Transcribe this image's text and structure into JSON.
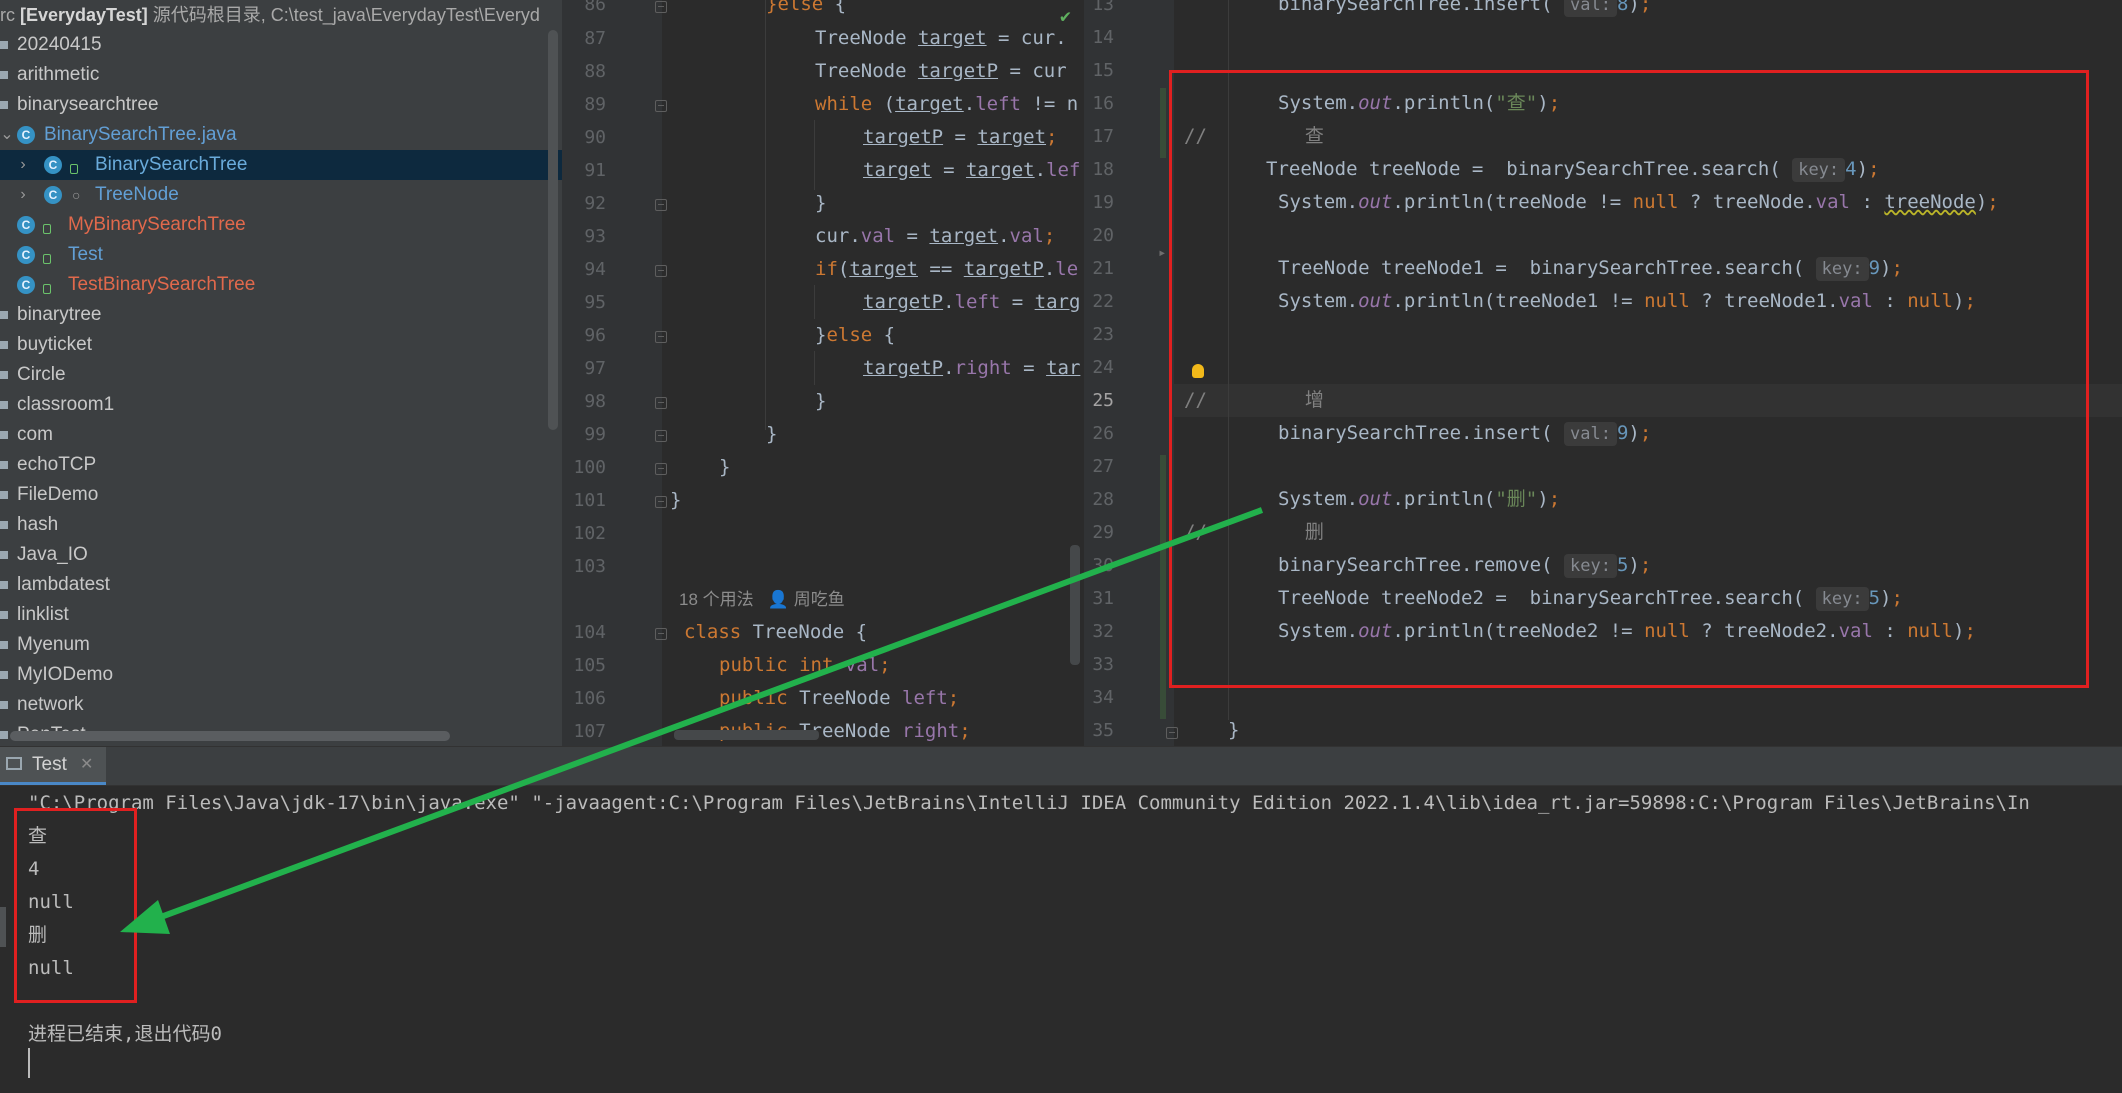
{
  "project": {
    "header_prefix": "rc ",
    "header_name": "[EverydayTest]",
    "header_path": " 源代码根目录, C:\\test_java\\EverydayTest\\Everyd",
    "items": [
      {
        "label": "20240415",
        "kind": "folder"
      },
      {
        "label": "arithmetic",
        "kind": "folder"
      },
      {
        "label": "binarysearchtree",
        "kind": "folder"
      },
      {
        "label": "BinarySearchTree.java",
        "kind": "file"
      },
      {
        "label": "BinarySearchTree",
        "kind": "class"
      },
      {
        "label": "TreeNode",
        "kind": "class"
      },
      {
        "label": "MyBinarySearchTree",
        "kind": "class"
      },
      {
        "label": "Test",
        "kind": "class"
      },
      {
        "label": "TestBinarySearchTree",
        "kind": "class"
      },
      {
        "label": "binarytree",
        "kind": "folder"
      },
      {
        "label": "buyticket",
        "kind": "folder"
      },
      {
        "label": "Circle",
        "kind": "folder"
      },
      {
        "label": "classroom1",
        "kind": "folder"
      },
      {
        "label": "com",
        "kind": "folder"
      },
      {
        "label": "echoTCP",
        "kind": "folder"
      },
      {
        "label": "FileDemo",
        "kind": "folder"
      },
      {
        "label": "hash",
        "kind": "folder"
      },
      {
        "label": "Java_IO",
        "kind": "folder"
      },
      {
        "label": "lambdatest",
        "kind": "folder"
      },
      {
        "label": "linklist",
        "kind": "folder"
      },
      {
        "label": "Myenum",
        "kind": "folder"
      },
      {
        "label": "MyIODemo",
        "kind": "folder"
      },
      {
        "label": "network",
        "kind": "folder"
      },
      {
        "label": "PenTest",
        "kind": "folder"
      }
    ]
  },
  "editor_left": {
    "line_numbers": [
      "86",
      "87",
      "88",
      "89",
      "90",
      "91",
      "92",
      "93",
      "94",
      "95",
      "96",
      "97",
      "98",
      "99",
      "100",
      "101",
      "102",
      "103",
      "104",
      "105",
      "106",
      "107"
    ],
    "usage_hint": "18 个用法",
    "author_hint": "周吃鱼"
  },
  "editor_right": {
    "line_numbers": [
      "13",
      "14",
      "15",
      "16",
      "17",
      "18",
      "19",
      "20",
      "21",
      "22",
      "23",
      "24",
      "25",
      "26",
      "27",
      "28",
      "29",
      "30",
      "31",
      "32",
      "33",
      "34",
      "35"
    ],
    "current_line": "25",
    "hint_val": "val:",
    "hint_key": "key:",
    "comment_search": "查",
    "comment_add": "增",
    "comment_delete": "删"
  },
  "run": {
    "tab_label": "Test",
    "command": "\"C:\\Program Files\\Java\\jdk-17\\bin\\java.exe\" \"-javaagent:C:\\Program Files\\JetBrains\\IntelliJ IDEA Community Edition 2022.1.4\\lib\\idea_rt.jar=59898:C:\\Program Files\\JetBrains\\In",
    "output": [
      "查",
      "4",
      "null",
      "删",
      "null"
    ],
    "exit_message": "进程已结束,退出代码0"
  },
  "colors": {
    "annotation_box": "#e02020",
    "annotation_arrow": "#22b14c"
  }
}
